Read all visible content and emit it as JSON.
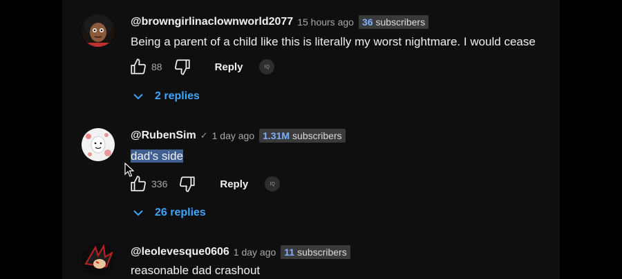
{
  "comments": [
    {
      "handle": "@browngirlinaclownworld2077",
      "time": "15 hours ago",
      "subs_count": "36",
      "subs_label": "subscribers",
      "text": "Being a parent of a child like this is literally my worst nightmare. I would cease",
      "likes": "88",
      "reply_label": "Reply",
      "iq_label": "IQ",
      "replies_label": "2 replies"
    },
    {
      "handle": "@RubenSim",
      "verified": "✓",
      "time": "1 day ago",
      "subs_count": "1.31M",
      "subs_label": "subscribers",
      "text": "dad's side",
      "likes": "336",
      "reply_label": "Reply",
      "iq_label": "IQ",
      "replies_label": "26 replies"
    },
    {
      "handle": "@leolevesque0606",
      "time": "1 day ago",
      "subs_count": "11",
      "subs_label": "subscribers",
      "text": "reasonable dad crashout"
    }
  ],
  "icons": {
    "like": "thumbs-up-icon",
    "dislike": "thumbs-down-icon",
    "replies": "chevron-down-icon"
  },
  "colors": {
    "background": "#0f0f0f",
    "link_blue": "#3ea6ff",
    "subs_number": "#7fb1ff",
    "selection": "#3f5f8f"
  }
}
